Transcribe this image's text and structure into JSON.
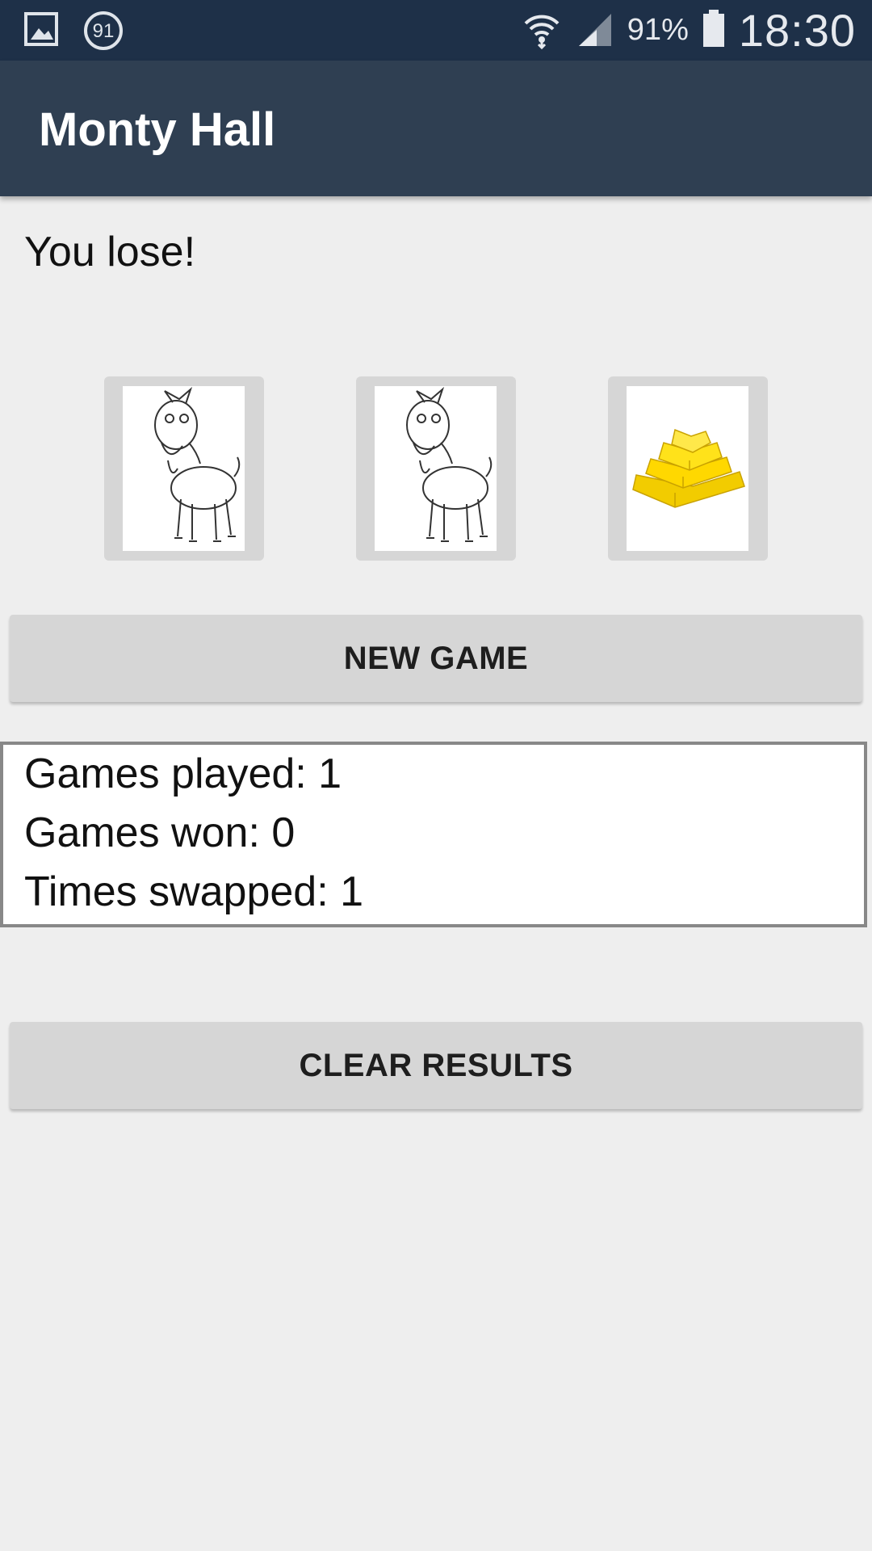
{
  "status_bar": {
    "icons": [
      "gallery-icon",
      "notification-91-icon",
      "wifi-icon",
      "signal-icon",
      "battery-icon"
    ],
    "notification_badge": "91",
    "battery_percent": "91%",
    "time": "18:30"
  },
  "app_bar": {
    "title": "Monty Hall"
  },
  "result": {
    "message": "You lose!"
  },
  "doors": [
    {
      "content": "goat-icon"
    },
    {
      "content": "goat-icon"
    },
    {
      "content": "gold-bars-icon"
    }
  ],
  "buttons": {
    "new_game": "NEW GAME",
    "clear_results": "CLEAR RESULTS"
  },
  "stats": {
    "games_played": "Games played: 1",
    "games_won": "Games won: 0",
    "times_swapped": "Times swapped: 1"
  },
  "colors": {
    "status_bar": "#1e3048",
    "app_bar": "#2f3f52",
    "background": "#eeeeee",
    "button": "#d6d6d6",
    "gold": "#f5d000"
  }
}
